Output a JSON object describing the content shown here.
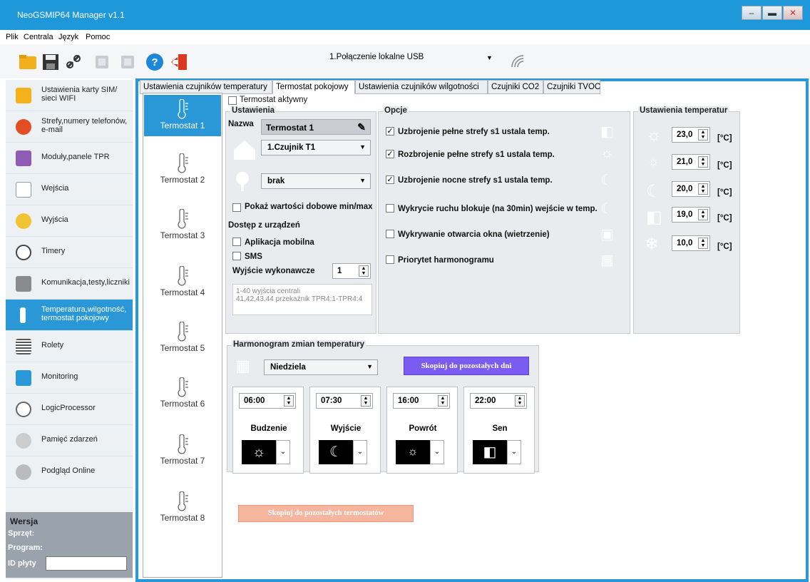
{
  "app": {
    "title": "NeoGSMIP64 Manager v1.1",
    "window_buttons": [
      "–",
      "▬",
      "✕"
    ]
  },
  "menu": [
    "Plik",
    "Centrala",
    "Język",
    "Pomoc"
  ],
  "connection": {
    "label": "1.Połączenie lokalne USB"
  },
  "nav": [
    {
      "label": "Ustawienia karty SIM/ sieci WIFI",
      "icon": "sim-card-icon",
      "color": "#f3b21c"
    },
    {
      "label": "Strefy,numery telefonów, e-mail",
      "icon": "pie-chart-icon",
      "color": "#e24d24"
    },
    {
      "label": "Moduły,panele TPR",
      "icon": "modules-icon",
      "color": "#8e5bb5"
    },
    {
      "label": "Wejścia",
      "icon": "input-icon",
      "color": "#e64545"
    },
    {
      "label": "Wyjścia",
      "icon": "bulb-icon",
      "color": "#f1c232"
    },
    {
      "label": "Timery",
      "icon": "clock-icon",
      "color": "#444"
    },
    {
      "label": "Komunikacja,testy,liczniki",
      "icon": "tools-icon",
      "color": "#8a8a8a"
    },
    {
      "label": "Temperatura,wilgotność, termostat pokojowy",
      "icon": "thermometer-icon",
      "color": "#e07a2f"
    },
    {
      "label": "Rolety",
      "icon": "blinds-icon",
      "color": "#555"
    },
    {
      "label": "Monitoring",
      "icon": "monitoring-icon",
      "color": "#2a97d6"
    },
    {
      "label": "LogicProcessor",
      "icon": "logic-icon",
      "color": "#666"
    },
    {
      "label": "Pamięć zdarzeń",
      "icon": "event-log-icon",
      "color": "#666"
    },
    {
      "label": "Podgląd Online",
      "icon": "online-preview-icon",
      "color": "#666"
    }
  ],
  "version": {
    "title": "Wersja",
    "hardware": "Sprzęt:",
    "program": "Program:",
    "board_id": "ID płyty"
  },
  "tabs": [
    "Ustawienia czujników temperatury",
    "Termostat pokojowy",
    "Ustawienia czujników wilgotności",
    "Czujniki CO2",
    "Czujniki TVOC"
  ],
  "thermostats": [
    "Termostat 1",
    "Termostat 2",
    "Termostat 3",
    "Termostat 4",
    "Termostat 5",
    "Termostat 6",
    "Termostat 7",
    "Termostat 8"
  ],
  "active_checkbox": "Termostat aktywny",
  "settings": {
    "title": "Ustawienia",
    "name_label": "Nazwa",
    "name_value": "Termostat 1",
    "sensor1": "1.Czujnik T1",
    "sensor2": "brak",
    "show_daily": "Pokaż wartości dobowe min/max",
    "access_label": "Dostęp z urządzeń",
    "mobile_app": "Aplikacja mobilna",
    "sms": "SMS",
    "output_label": "Wyjście wykonawcze",
    "output_value": "1",
    "output_hint1": "1-40 wyjścia centrali",
    "output_hint2": "41,42,43,44 przekaźnik TPR4:1-TPR4:4"
  },
  "options": {
    "title": "Opcje",
    "items": [
      {
        "label": "Uzbrojenie pełne strefy s1 ustala temp.",
        "checked": true,
        "icon": "door-exit-icon"
      },
      {
        "label": "Rozbrojenie pełne strefy s1 ustala temp.",
        "checked": true,
        "icon": "sun-icon"
      },
      {
        "label": "Uzbrojenie nocne strefy s1 ustala temp.",
        "checked": true,
        "icon": "moon-icon"
      },
      {
        "label": "Wykrycie ruchu blokuje (na 30min) wejście w temp.",
        "checked": false,
        "icon": "moon-icon"
      },
      {
        "label": "Wykrywanie otwarcia okna (wietrzenie)",
        "checked": false,
        "icon": "window-icon"
      },
      {
        "label": "Priorytet harmonogramu",
        "checked": false,
        "icon": "calendar-icon"
      }
    ]
  },
  "temps": {
    "title": "Ustawienia temperatur",
    "unit": "[°C]",
    "rows": [
      {
        "value": "23,0",
        "icon": "sun-icon"
      },
      {
        "value": "21,0",
        "icon": "sun-small-icon"
      },
      {
        "value": "20,0",
        "icon": "moon-icon"
      },
      {
        "value": "19,0",
        "icon": "door-exit-icon"
      },
      {
        "value": "10,0",
        "icon": "snowflake-icon"
      }
    ]
  },
  "schedule": {
    "title": "Harmonogram zmian temperatury",
    "day": "Niedziela",
    "copy_days": "Skopiuj do pozostałych dni",
    "cards": [
      {
        "time": "06:00",
        "label": "Budzenie",
        "icon": "sun-icon"
      },
      {
        "time": "07:30",
        "label": "Wyjście",
        "icon": "moon-icon"
      },
      {
        "time": "16:00",
        "label": "Powrót",
        "icon": "sun-small-icon"
      },
      {
        "time": "22:00",
        "label": "Sen",
        "icon": "door-exit-icon"
      }
    ]
  },
  "copy_thermostats": "Skopiuj do pozostałych termostatów"
}
